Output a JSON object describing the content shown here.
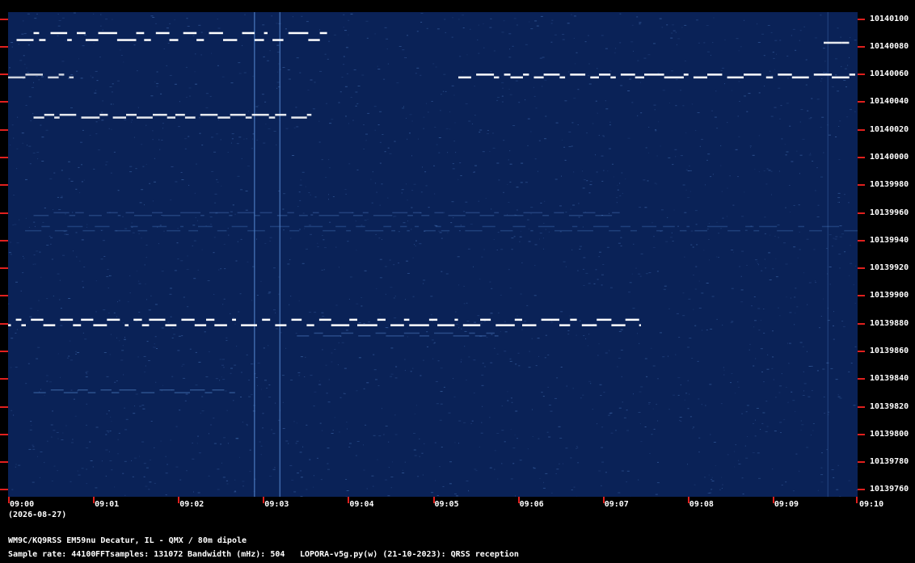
{
  "chart_data": {
    "type": "heatmap",
    "description_lines": {
      "date": "(2026-08-27)",
      "station": "WM9C/KQ9RSS EM59nu Decatur, IL - QMX / 80m dipole",
      "sample_rate": "Sample rate: 44100",
      "fft_samples": "FFTsamples: 131072",
      "bandwidth": "Bandwidth (mHz): 504",
      "software": "LOPORA-v5g.py(w) (21-10-2023): QRSS reception"
    },
    "x_tick_labels": [
      "09:00",
      "09:01",
      "09:02",
      "09:03",
      "09:04",
      "09:05",
      "09:06",
      "09:07",
      "09:08",
      "09:09",
      "09:10"
    ],
    "y_tick_labels": [
      "10140100",
      "10140080",
      "10140060",
      "10140040",
      "10140020",
      "10140000",
      "10139980",
      "10139960",
      "10139940",
      "10139920",
      "10139900",
      "10139880",
      "10139860",
      "10139840",
      "10139820",
      "10139800",
      "10139780",
      "10139760"
    ],
    "x_range_minutes": [
      0,
      10
    ],
    "y_range_hz": [
      10139755,
      10140105
    ],
    "colors": {
      "background": "#0a2257",
      "tick": "#e0201e",
      "signal": "#ffffff",
      "faint_signal": "#4f7fc6"
    },
    "traces": [
      {
        "name": "",
        "freq_hz": 10140085,
        "shift_hz": 5,
        "start_min": 0.1,
        "end_min": 3.8,
        "strength": 1.0
      },
      {
        "name": "",
        "freq_hz": 10140058,
        "shift_hz": 2,
        "start_min": 0.0,
        "end_min": 0.8,
        "strength": 0.7
      },
      {
        "name": "",
        "freq_hz": 10140058,
        "shift_hz": 2,
        "start_min": 5.3,
        "end_min": 10.0,
        "strength": 1.0
      },
      {
        "name": "",
        "freq_hz": 10140029,
        "shift_hz": 2,
        "start_min": 0.3,
        "end_min": 3.6,
        "strength": 0.8
      },
      {
        "name": "",
        "freq_hz": 10139958,
        "shift_hz": 2,
        "start_min": 0.3,
        "end_min": 7.2,
        "strength": 0.25
      },
      {
        "name": "",
        "freq_hz": 10139947,
        "shift_hz": 3,
        "start_min": 0.2,
        "end_min": 10.0,
        "strength": 0.22
      },
      {
        "name": "",
        "freq_hz": 10139879,
        "shift_hz": 4,
        "start_min": 0.0,
        "end_min": 7.45,
        "strength": 1.0
      },
      {
        "name": "",
        "freq_hz": 10139871,
        "shift_hz": 2,
        "start_min": 3.4,
        "end_min": 5.8,
        "strength": 0.35
      },
      {
        "name": "",
        "freq_hz": 10139830,
        "shift_hz": 2,
        "start_min": 0.3,
        "end_min": 2.7,
        "strength": 0.4
      },
      {
        "name": "",
        "freq_hz": 10140083,
        "shift_hz": 0,
        "start_min": 9.6,
        "end_min": 9.9,
        "strength": 0.8
      }
    ],
    "vertical_lines_min": [
      2.9,
      3.2,
      9.65
    ]
  }
}
